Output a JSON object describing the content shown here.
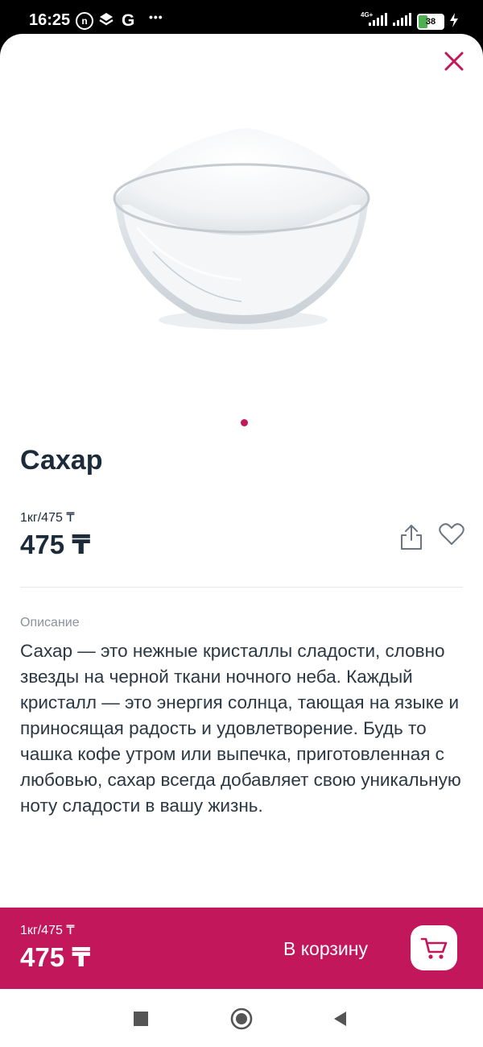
{
  "status_bar": {
    "time": "16:25",
    "left_icons": [
      "notification-n-icon",
      "layers-icon",
      "google-icon",
      "more-dots-icon"
    ],
    "google_glyph": "G",
    "more_glyph": "•••",
    "network": "4G+",
    "battery_level": "38"
  },
  "product": {
    "title": "Сахар",
    "unit_price": "1кг/475 ₸",
    "price": "475 ₸",
    "image_count": 1,
    "active_image": 1
  },
  "description": {
    "label": "Описание",
    "text": "Сахар — это нежные кристаллы сладости, словно звезды на черной ткани ночного неба. Каждый кристалл — это энергия солнца, тающая на языке и приносящая радость и удовлетворение. Будь то чашка кофе утром или выпечка, приготовленная с любовью, сахар всегда добавляет свою уникальную ноту сладости в вашу жизнь."
  },
  "cart_bar": {
    "unit_price": "1кг/475 ₸",
    "price": "475 ₸",
    "button_label": "В корзину"
  },
  "colors": {
    "accent": "#c2185b",
    "text": "#1c2b3a",
    "muted": "#8a939c",
    "battery": "#4caf50"
  }
}
